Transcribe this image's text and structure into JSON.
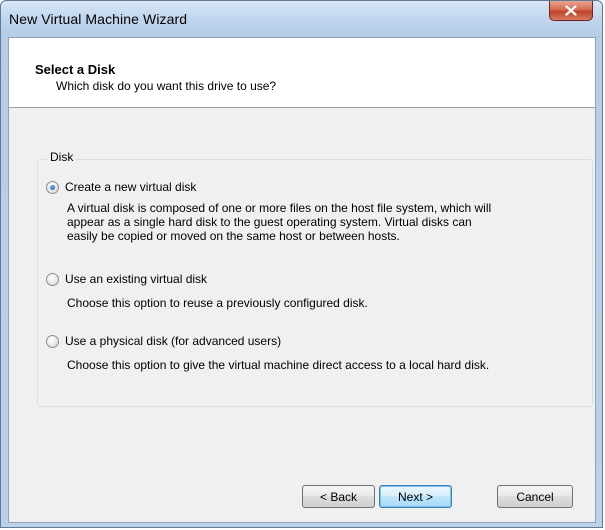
{
  "window": {
    "title": "New Virtual Machine Wizard"
  },
  "header": {
    "title": "Select a Disk",
    "subtitle": "Which disk do you want this drive to use?"
  },
  "disk_group": {
    "label": "Disk",
    "options": [
      {
        "label": "Create a new virtual disk",
        "selected": true,
        "description_lines": [
          "A virtual disk is composed of one or more files on the host file system, which will",
          "appear as a single hard disk to the guest operating system. Virtual disks can",
          "easily be copied or moved on the same host or between hosts."
        ]
      },
      {
        "label": "Use an existing virtual disk",
        "selected": false,
        "description_lines": [
          "Choose this option to reuse a previously configured disk."
        ]
      },
      {
        "label": "Use a physical disk (for advanced users)",
        "selected": false,
        "description_lines": [
          "Choose this option to give the virtual machine direct access to a local hard disk."
        ]
      }
    ]
  },
  "buttons": {
    "back": "< Back",
    "next": "Next >",
    "cancel": "Cancel"
  },
  "icons": {
    "close": "close-icon"
  }
}
